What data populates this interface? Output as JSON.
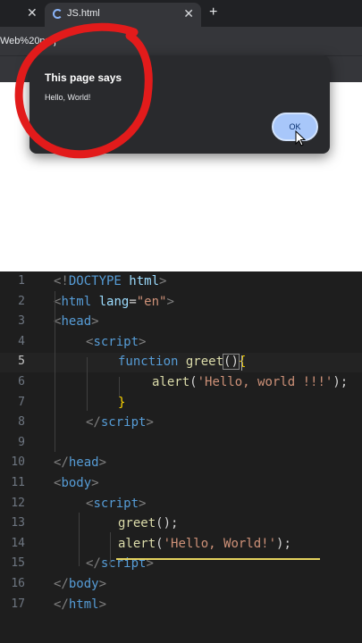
{
  "browser": {
    "prev_tab_close": "✕",
    "active_tab": {
      "title": "JS.html",
      "close": "✕"
    },
    "new_tab": "+",
    "url": "Web%20proj"
  },
  "dialog": {
    "title": "This page says",
    "message": "Hello, World!",
    "ok_label": "OK"
  },
  "editor": {
    "lines": [
      {
        "n": "1",
        "indent": 0,
        "tokens": [
          [
            "<!",
            "t"
          ],
          [
            "DOCTYPE",
            "k"
          ],
          [
            " html",
            "a"
          ],
          [
            ">",
            "t"
          ]
        ]
      },
      {
        "n": "2",
        "indent": 0,
        "tokens": [
          [
            "<",
            "t"
          ],
          [
            "html",
            "k"
          ],
          [
            " lang",
            "a"
          ],
          [
            "=",
            "p"
          ],
          [
            "\"en\"",
            "s"
          ],
          [
            ">",
            "t"
          ]
        ]
      },
      {
        "n": "3",
        "indent": 0,
        "tokens": [
          [
            "<",
            "t"
          ],
          [
            "head",
            "k"
          ],
          [
            ">",
            "t"
          ]
        ]
      },
      {
        "n": "4",
        "indent": 1,
        "tokens": [
          [
            "<",
            "t"
          ],
          [
            "script",
            "k"
          ],
          [
            ">",
            "t"
          ]
        ]
      },
      {
        "n": "5",
        "indent": 2,
        "tokens": [
          [
            "function",
            "f"
          ],
          [
            " ",
            "p"
          ],
          [
            "greet",
            "n"
          ],
          [
            "()",
            "b"
          ],
          [
            "{",
            "y"
          ]
        ]
      },
      {
        "n": "6",
        "indent": 3,
        "tokens": [
          [
            "alert",
            "n"
          ],
          [
            "(",
            "p"
          ],
          [
            "'Hello, world !!!'",
            "s"
          ],
          [
            ");",
            "p"
          ]
        ]
      },
      {
        "n": "7",
        "indent": 2,
        "tokens": [
          [
            "}",
            "y"
          ]
        ]
      },
      {
        "n": "8",
        "indent": 1,
        "tokens": [
          [
            "</",
            "t"
          ],
          [
            "script",
            "k"
          ],
          [
            ">",
            "t"
          ]
        ]
      },
      {
        "n": "9",
        "indent": 0,
        "tokens": []
      },
      {
        "n": "10",
        "indent": 0,
        "tokens": [
          [
            "</",
            "t"
          ],
          [
            "head",
            "k"
          ],
          [
            ">",
            "t"
          ]
        ]
      },
      {
        "n": "11",
        "indent": 0,
        "tokens": [
          [
            "<",
            "t"
          ],
          [
            "body",
            "k"
          ],
          [
            ">",
            "t"
          ]
        ]
      },
      {
        "n": "12",
        "indent": 1,
        "tokens": [
          [
            "<",
            "t"
          ],
          [
            "script",
            "k"
          ],
          [
            ">",
            "t"
          ]
        ]
      },
      {
        "n": "13",
        "indent": 2,
        "tokens": [
          [
            "greet",
            "n"
          ],
          [
            "();",
            "p"
          ]
        ]
      },
      {
        "n": "14",
        "indent": 2,
        "tokens": [
          [
            "alert",
            "n"
          ],
          [
            "(",
            "p"
          ],
          [
            "'Hello, World!'",
            "s"
          ],
          [
            ");",
            "p"
          ]
        ]
      },
      {
        "n": "15",
        "indent": 1,
        "tokens": [
          [
            "</",
            "t"
          ],
          [
            "script",
            "k"
          ],
          [
            ">",
            "t"
          ]
        ]
      },
      {
        "n": "16",
        "indent": 0,
        "tokens": [
          [
            "</",
            "t"
          ],
          [
            "body",
            "k"
          ],
          [
            ">",
            "t"
          ]
        ]
      },
      {
        "n": "17",
        "indent": 0,
        "tokens": [
          [
            "</",
            "t"
          ],
          [
            "html",
            "k"
          ],
          [
            ">",
            "t"
          ]
        ]
      }
    ],
    "current_line": "5"
  },
  "colors": {
    "tag_bracket": "#808080",
    "keyword": "#569cd6",
    "attribute": "#9cdcfe",
    "string": "#ce9178",
    "function_name": "#dcdcaa",
    "paren": "#d4d4d4",
    "brace": "#ffd700",
    "plain": "#d4d4d4",
    "annotation_red": "#e21b1b",
    "underline_yellow": "#e5d35f"
  }
}
